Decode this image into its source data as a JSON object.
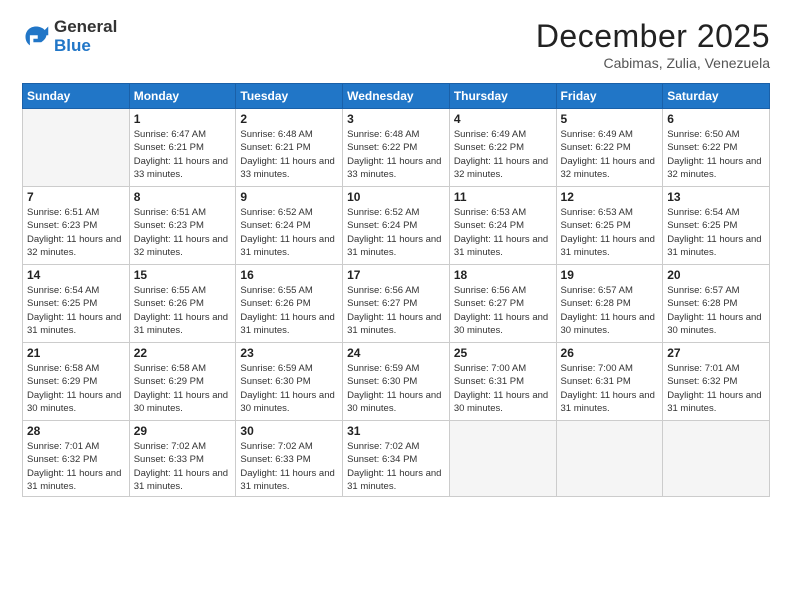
{
  "logo": {
    "general": "General",
    "blue": "Blue"
  },
  "title": "December 2025",
  "location": "Cabimas, Zulia, Venezuela",
  "headers": [
    "Sunday",
    "Monday",
    "Tuesday",
    "Wednesday",
    "Thursday",
    "Friday",
    "Saturday"
  ],
  "weeks": [
    [
      {
        "day": "",
        "sunrise": "",
        "sunset": "",
        "daylight": ""
      },
      {
        "day": "1",
        "sunrise": "Sunrise: 6:47 AM",
        "sunset": "Sunset: 6:21 PM",
        "daylight": "Daylight: 11 hours and 33 minutes."
      },
      {
        "day": "2",
        "sunrise": "Sunrise: 6:48 AM",
        "sunset": "Sunset: 6:21 PM",
        "daylight": "Daylight: 11 hours and 33 minutes."
      },
      {
        "day": "3",
        "sunrise": "Sunrise: 6:48 AM",
        "sunset": "Sunset: 6:22 PM",
        "daylight": "Daylight: 11 hours and 33 minutes."
      },
      {
        "day": "4",
        "sunrise": "Sunrise: 6:49 AM",
        "sunset": "Sunset: 6:22 PM",
        "daylight": "Daylight: 11 hours and 32 minutes."
      },
      {
        "day": "5",
        "sunrise": "Sunrise: 6:49 AM",
        "sunset": "Sunset: 6:22 PM",
        "daylight": "Daylight: 11 hours and 32 minutes."
      },
      {
        "day": "6",
        "sunrise": "Sunrise: 6:50 AM",
        "sunset": "Sunset: 6:22 PM",
        "daylight": "Daylight: 11 hours and 32 minutes."
      }
    ],
    [
      {
        "day": "7",
        "sunrise": "Sunrise: 6:51 AM",
        "sunset": "Sunset: 6:23 PM",
        "daylight": "Daylight: 11 hours and 32 minutes."
      },
      {
        "day": "8",
        "sunrise": "Sunrise: 6:51 AM",
        "sunset": "Sunset: 6:23 PM",
        "daylight": "Daylight: 11 hours and 32 minutes."
      },
      {
        "day": "9",
        "sunrise": "Sunrise: 6:52 AM",
        "sunset": "Sunset: 6:24 PM",
        "daylight": "Daylight: 11 hours and 31 minutes."
      },
      {
        "day": "10",
        "sunrise": "Sunrise: 6:52 AM",
        "sunset": "Sunset: 6:24 PM",
        "daylight": "Daylight: 11 hours and 31 minutes."
      },
      {
        "day": "11",
        "sunrise": "Sunrise: 6:53 AM",
        "sunset": "Sunset: 6:24 PM",
        "daylight": "Daylight: 11 hours and 31 minutes."
      },
      {
        "day": "12",
        "sunrise": "Sunrise: 6:53 AM",
        "sunset": "Sunset: 6:25 PM",
        "daylight": "Daylight: 11 hours and 31 minutes."
      },
      {
        "day": "13",
        "sunrise": "Sunrise: 6:54 AM",
        "sunset": "Sunset: 6:25 PM",
        "daylight": "Daylight: 11 hours and 31 minutes."
      }
    ],
    [
      {
        "day": "14",
        "sunrise": "Sunrise: 6:54 AM",
        "sunset": "Sunset: 6:25 PM",
        "daylight": "Daylight: 11 hours and 31 minutes."
      },
      {
        "day": "15",
        "sunrise": "Sunrise: 6:55 AM",
        "sunset": "Sunset: 6:26 PM",
        "daylight": "Daylight: 11 hours and 31 minutes."
      },
      {
        "day": "16",
        "sunrise": "Sunrise: 6:55 AM",
        "sunset": "Sunset: 6:26 PM",
        "daylight": "Daylight: 11 hours and 31 minutes."
      },
      {
        "day": "17",
        "sunrise": "Sunrise: 6:56 AM",
        "sunset": "Sunset: 6:27 PM",
        "daylight": "Daylight: 11 hours and 31 minutes."
      },
      {
        "day": "18",
        "sunrise": "Sunrise: 6:56 AM",
        "sunset": "Sunset: 6:27 PM",
        "daylight": "Daylight: 11 hours and 30 minutes."
      },
      {
        "day": "19",
        "sunrise": "Sunrise: 6:57 AM",
        "sunset": "Sunset: 6:28 PM",
        "daylight": "Daylight: 11 hours and 30 minutes."
      },
      {
        "day": "20",
        "sunrise": "Sunrise: 6:57 AM",
        "sunset": "Sunset: 6:28 PM",
        "daylight": "Daylight: 11 hours and 30 minutes."
      }
    ],
    [
      {
        "day": "21",
        "sunrise": "Sunrise: 6:58 AM",
        "sunset": "Sunset: 6:29 PM",
        "daylight": "Daylight: 11 hours and 30 minutes."
      },
      {
        "day": "22",
        "sunrise": "Sunrise: 6:58 AM",
        "sunset": "Sunset: 6:29 PM",
        "daylight": "Daylight: 11 hours and 30 minutes."
      },
      {
        "day": "23",
        "sunrise": "Sunrise: 6:59 AM",
        "sunset": "Sunset: 6:30 PM",
        "daylight": "Daylight: 11 hours and 30 minutes."
      },
      {
        "day": "24",
        "sunrise": "Sunrise: 6:59 AM",
        "sunset": "Sunset: 6:30 PM",
        "daylight": "Daylight: 11 hours and 30 minutes."
      },
      {
        "day": "25",
        "sunrise": "Sunrise: 7:00 AM",
        "sunset": "Sunset: 6:31 PM",
        "daylight": "Daylight: 11 hours and 30 minutes."
      },
      {
        "day": "26",
        "sunrise": "Sunrise: 7:00 AM",
        "sunset": "Sunset: 6:31 PM",
        "daylight": "Daylight: 11 hours and 31 minutes."
      },
      {
        "day": "27",
        "sunrise": "Sunrise: 7:01 AM",
        "sunset": "Sunset: 6:32 PM",
        "daylight": "Daylight: 11 hours and 31 minutes."
      }
    ],
    [
      {
        "day": "28",
        "sunrise": "Sunrise: 7:01 AM",
        "sunset": "Sunset: 6:32 PM",
        "daylight": "Daylight: 11 hours and 31 minutes."
      },
      {
        "day": "29",
        "sunrise": "Sunrise: 7:02 AM",
        "sunset": "Sunset: 6:33 PM",
        "daylight": "Daylight: 11 hours and 31 minutes."
      },
      {
        "day": "30",
        "sunrise": "Sunrise: 7:02 AM",
        "sunset": "Sunset: 6:33 PM",
        "daylight": "Daylight: 11 hours and 31 minutes."
      },
      {
        "day": "31",
        "sunrise": "Sunrise: 7:02 AM",
        "sunset": "Sunset: 6:34 PM",
        "daylight": "Daylight: 11 hours and 31 minutes."
      },
      {
        "day": "",
        "sunrise": "",
        "sunset": "",
        "daylight": ""
      },
      {
        "day": "",
        "sunrise": "",
        "sunset": "",
        "daylight": ""
      },
      {
        "day": "",
        "sunrise": "",
        "sunset": "",
        "daylight": ""
      }
    ]
  ]
}
